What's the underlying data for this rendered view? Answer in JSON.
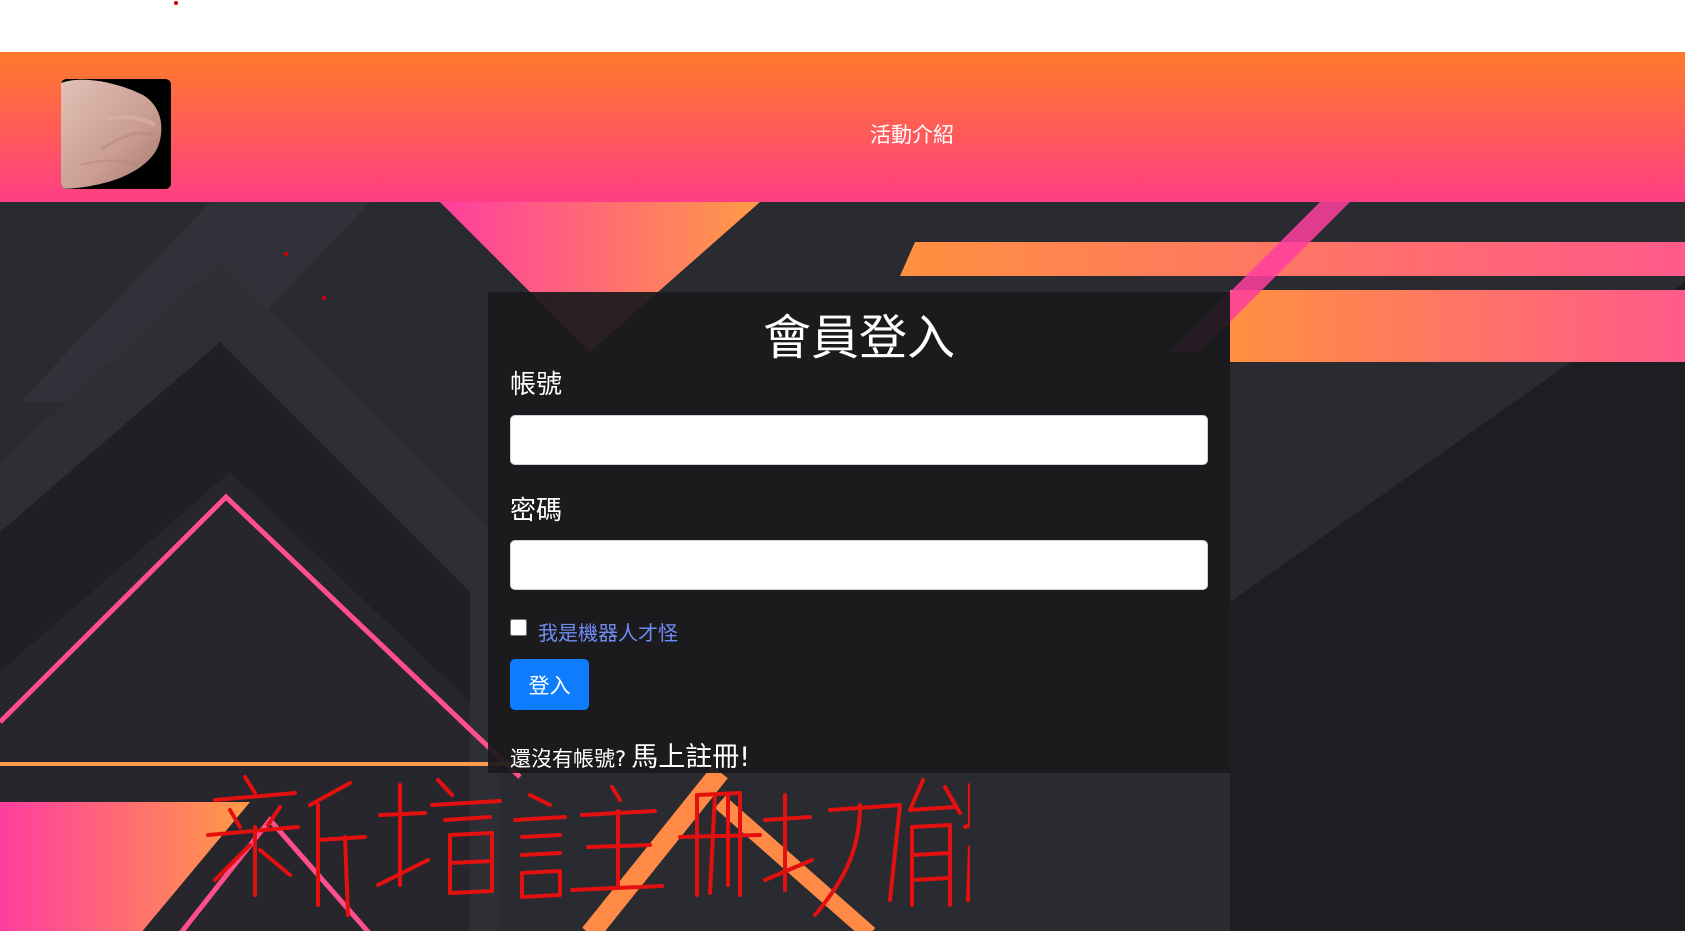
{
  "navbar": {
    "logo_icon": "avatar-photo",
    "links": [
      {
        "label": "活動介紹"
      }
    ]
  },
  "login_card": {
    "title": "會員登入",
    "username_label": "帳號",
    "username_value": "",
    "password_label": "密碼",
    "password_value": "",
    "robot_checkbox_label": "我是機器人才怪",
    "robot_checked": false,
    "login_button": "登入",
    "register_prompt": "還沒有帳號?",
    "register_link": "馬上註冊!"
  },
  "annotation": {
    "text": "新增註冊功能",
    "color": "#e31010"
  },
  "colors": {
    "navbar_gradient": [
      "#ff7a2a",
      "#ff3e86"
    ],
    "button": "#0d7cfd",
    "checkbox_label": "#6f8cf5",
    "hero_background": "#26262d"
  }
}
